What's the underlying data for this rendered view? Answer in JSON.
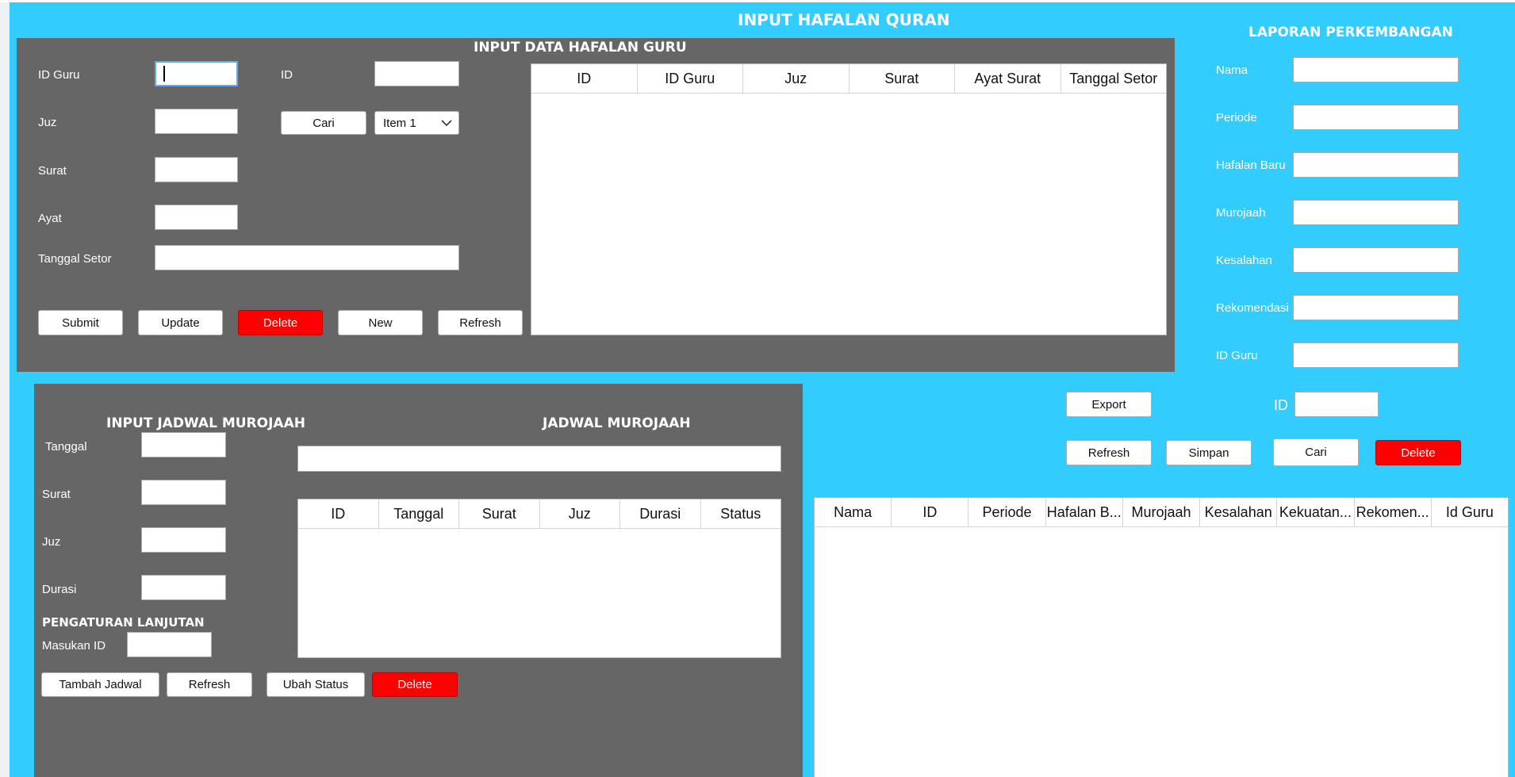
{
  "app": {
    "title": "INPUT HAFALAN QURAN"
  },
  "hafalan_panel": {
    "title": "INPUT DATA HAFALAN GURU",
    "labels": {
      "id_guru": "ID Guru",
      "id": "ID",
      "juz": "Juz",
      "surat": "Surat",
      "ayat": "Ayat",
      "tanggal_setor": "Tanggal Setor"
    },
    "values": {
      "id_guru": "",
      "id": "",
      "juz": "",
      "surat": "",
      "ayat": "",
      "tanggal_setor": ""
    },
    "cari_label": "Cari",
    "combo_selected": "Item 1",
    "buttons": {
      "submit": "Submit",
      "update": "Update",
      "delete": "Delete",
      "new": "New",
      "refresh": "Refresh"
    },
    "table": {
      "columns": [
        "ID",
        "ID Guru",
        "Juz",
        "Surat",
        "Ayat Surat",
        "Tanggal Setor"
      ],
      "rows": []
    }
  },
  "laporan_panel": {
    "title": "LAPORAN PERKEMBANGAN",
    "labels": {
      "nama": "Nama",
      "periode": "Periode",
      "hafalan_baru": "Hafalan Baru",
      "murojaah": "Murojaah",
      "kesalahan": "Kesalahan",
      "rekomendasi": "Rekomendasi",
      "id_guru": "ID Guru",
      "id": "ID"
    },
    "values": {
      "nama": "",
      "periode": "",
      "hafalan_baru": "",
      "murojaah": "",
      "kesalahan": "",
      "rekomendasi": "",
      "id_guru": "",
      "id": ""
    },
    "buttons": {
      "export": "Export",
      "refresh": "Refresh",
      "simpan": "Simpan",
      "cari": "Cari",
      "delete": "Delete"
    },
    "table": {
      "columns": [
        "Nama",
        "ID",
        "Periode",
        "Hafalan B...",
        "Murojaah",
        "Kesalahan",
        "Kekuatan...",
        "Rekomen...",
        "Id Guru"
      ],
      "rows": []
    }
  },
  "murojaah_panel": {
    "input_title": "INPUT JADWAL MUROJAAH",
    "jadwal_title": "JADWAL MUROJAAH",
    "labels": {
      "tanggal": "Tanggal",
      "surat": "Surat",
      "juz": "Juz",
      "durasi": "Durasi",
      "pengaturan": "PENGATURAN LANJUTAN",
      "masukan_id": "Masukan ID"
    },
    "values": {
      "tanggal": "",
      "surat": "",
      "juz": "",
      "durasi": "",
      "masukan_id": "",
      "search": ""
    },
    "buttons": {
      "tambah": "Tambah Jadwal",
      "refresh": "Refresh",
      "ubah_status": "Ubah Status",
      "delete": "Delete"
    },
    "table": {
      "columns": [
        "ID",
        "Tanggal",
        "Surat",
        "Juz",
        "Durasi",
        "Status"
      ],
      "rows": []
    }
  },
  "colors": {
    "background": "#33ccff",
    "panel": "#666666",
    "danger": "#ff0000"
  }
}
